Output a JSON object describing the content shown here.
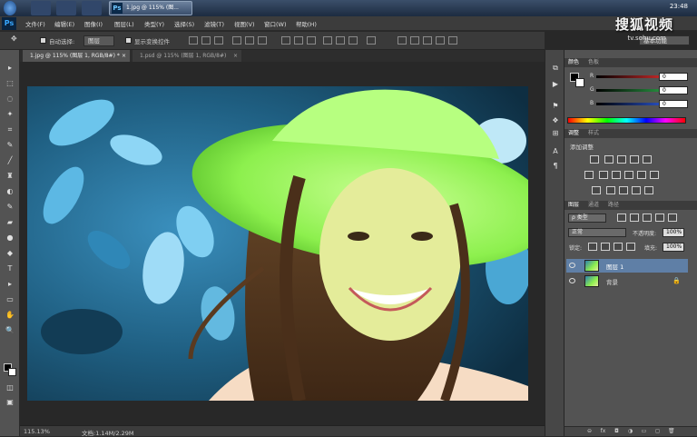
{
  "taskbar": {
    "ps_task_label": "1.jpg @ 115% (图...",
    "ps_icon_text": "Ps",
    "clock": "23:48"
  },
  "menubar": {
    "logo": "Ps",
    "items": [
      "文件(F)",
      "编辑(E)",
      "图像(I)",
      "图层(L)",
      "类型(Y)",
      "选择(S)",
      "滤镜(T)",
      "视图(V)",
      "窗口(W)",
      "帮助(H)"
    ]
  },
  "watermark": {
    "brand": "搜狐视频",
    "url": "tv.sohu.com"
  },
  "options": {
    "auto_select_label": "自动选择:",
    "auto_select_value": "图层",
    "show_transform_label": "显示变换控件",
    "workspace_value": "基本功能"
  },
  "tabs": [
    {
      "label": "1.jpg @ 115% (图层 1, RGB/8#) *",
      "close": "×"
    },
    {
      "label": "1.psd @ 115% (图层 1, RGB/8#)",
      "close": "×"
    }
  ],
  "tools": [
    "▸",
    "⬚",
    "◌",
    "✦",
    "⌗",
    "✎",
    "╱",
    "♜",
    "◐",
    "✎",
    "▰",
    "●",
    "◆",
    "T",
    "▸",
    "▭",
    "✋",
    "🔍"
  ],
  "statusbar": {
    "zoom": "115.13%",
    "doc_info": "文档:1.14M/2.29M"
  },
  "color_panel": {
    "tabs": [
      "颜色",
      "色板"
    ],
    "channels": [
      {
        "label": "R",
        "value": "0",
        "color": "#e53030"
      },
      {
        "label": "G",
        "value": "0",
        "color": "#2ea84a"
      },
      {
        "label": "B",
        "value": "0",
        "color": "#2f5de0"
      }
    ]
  },
  "adjust_panel": {
    "tabs": [
      "调整",
      "样式"
    ],
    "title": "添加调整"
  },
  "layers_panel": {
    "tabs": [
      "图层",
      "通道",
      "路径"
    ],
    "kind_filter": "ρ 类型",
    "blend_mode": "正常",
    "opacity_label": "不透明度:",
    "opacity_value": "100%",
    "lock_label": "锁定:",
    "fill_label": "填充:",
    "fill_value": "100%",
    "layers": [
      {
        "name": "图层 1",
        "selected": true
      },
      {
        "name": "背景",
        "selected": false,
        "locked": true
      }
    ],
    "footer_icons": [
      "⊖",
      "fx",
      "◘",
      "◑",
      "▭",
      "◻",
      "🗑"
    ]
  },
  "colors": {
    "accent_selected": "#5f7fa6",
    "panel_bg": "#535353"
  }
}
